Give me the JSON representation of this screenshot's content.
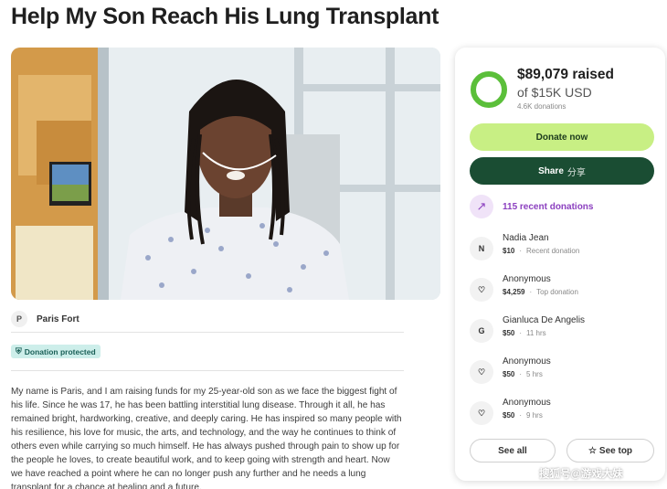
{
  "page": {
    "title": "Help My Son Reach His Lung Transplant"
  },
  "photo": {
    "alt": "Young man with long locs wearing a hospital gown and nasal cannula",
    "prev_icon": "chevron-left-icon",
    "next_icon": "arrow-right-icon"
  },
  "organizer": {
    "initial": "P",
    "name": "Paris Fort"
  },
  "badge": {
    "icon": "shield-icon",
    "label": "Donation protected"
  },
  "story": {
    "text": "My name is Paris, and I am raising funds for my 25-year-old son as we face the biggest fight of his life. Since he was 17, he has been battling interstitial lung disease. Through it all, he has remained bright, hardworking, creative, and deeply caring. He has inspired so many people with his resilience, his love for music, the arts, and technology, and the way he continues to think of others even while carrying so much himself. He has always pushed through pain to show up for the people he loves, to create beautiful work, and to keep going with strength and heart. Now we have reached a point where he can no longer push any further and he needs a lung transplant for a chance at healing and a future."
  },
  "donation_panel": {
    "raised": "$89,079 raised",
    "goal": "of $15K USD",
    "count": "4.6K donations",
    "progress_fraction": 1.0,
    "donate_label": "Donate now",
    "share_label": "Share",
    "share_label_cn": "分享",
    "recent_label": "115 recent donations",
    "donors": [
      {
        "avatar": "N",
        "name": "Nadia Jean",
        "amount": "$10",
        "note": "Recent donation"
      },
      {
        "avatar": "heart-hand-icon",
        "name": "Anonymous",
        "amount": "$4,259",
        "note": "Top donation"
      },
      {
        "avatar": "G",
        "name": "Gianluca De Angelis",
        "amount": "$50",
        "note": "11 hrs"
      },
      {
        "avatar": "heart-hand-icon",
        "name": "Anonymous",
        "amount": "$50",
        "note": "5 hrs"
      },
      {
        "avatar": "heart-hand-icon",
        "name": "Anonymous",
        "amount": "$50",
        "note": "9 hrs"
      }
    ],
    "see_all_label": "See all",
    "see_top_label": "See top"
  },
  "watermark": "搜狐号@游戏大妹",
  "colors": {
    "accent_green": "#c8ef84",
    "dark_green": "#1a4d33",
    "progress_green": "#5bbf3a",
    "recent_purple": "#8b3fbf",
    "badge_bg": "#cdeeea"
  }
}
